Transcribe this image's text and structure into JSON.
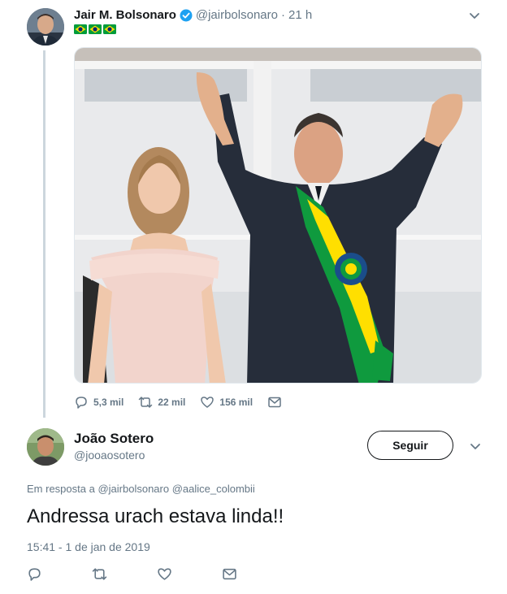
{
  "tweet": {
    "author_name": "Jair M. Bolsonaro",
    "handle": "@jairbolsonaro",
    "time_ago": "21 h",
    "separator": "·",
    "replies": "5,3 mil",
    "retweets": "22 mil",
    "likes": "156 mil"
  },
  "reply": {
    "author_name": "João Sotero",
    "handle": "@jooaosotero",
    "follow_label": "Seguir",
    "in_reply_prefix": "Em resposta a",
    "mention_1": "@jairbolsonaro",
    "mention_2": "@aalice_colombii",
    "text": "Andressa urach estava linda!!",
    "timestamp": "15:41 - 1 de jan de 2019"
  },
  "colors": {
    "accent": "#1da1f2",
    "secondary_text": "#657786",
    "primary_text": "#14171a",
    "thread_line": "#ccd6dd",
    "flag_green": "#009c3b",
    "flag_yellow": "#ffdf00",
    "flag_blue": "#002776"
  },
  "icons": [
    "verified-badge-icon",
    "brazil-flag-icon",
    "chevron-down-icon",
    "reply-icon",
    "retweet-icon",
    "like-icon",
    "share-icon"
  ]
}
